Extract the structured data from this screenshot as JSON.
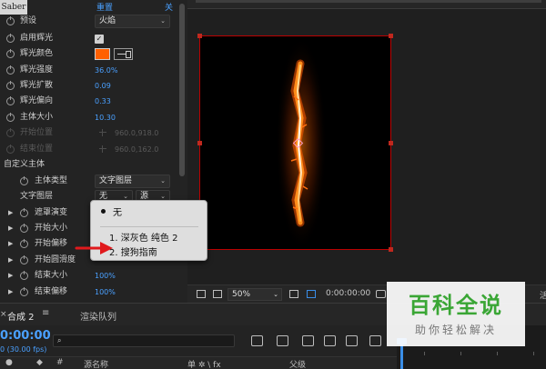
{
  "effects_panel": {
    "badge": "Saber",
    "reset": "重置",
    "about": "关",
    "rows": [
      {
        "label": "预设",
        "value": "火焰"
      },
      {
        "label": "启用辉光",
        "value": "✓"
      },
      {
        "label": "辉光颜色",
        "value": ""
      },
      {
        "label": "辉光强度",
        "value": "36.0%"
      },
      {
        "label": "辉光扩散",
        "value": "0.09"
      },
      {
        "label": "辉光偏向",
        "value": "0.33"
      },
      {
        "label": "主体大小",
        "value": "10.30"
      },
      {
        "label": "开始位置",
        "value": "960.0,918.0"
      },
      {
        "label": "结束位置",
        "value": "960.0,162.0"
      }
    ],
    "section_title": "自定义主体",
    "body_type_label": "主体类型",
    "body_type_value": "文字图层",
    "text_layer_label": "文字图层",
    "text_layer_value": "无",
    "text_layer_source": "源",
    "collapsed_rows": [
      {
        "label": "遮罩演变",
        "value": ""
      },
      {
        "label": "开始大小",
        "value": ""
      },
      {
        "label": "开始偏移",
        "value": ""
      },
      {
        "label": "开始圆滑度",
        "value": ""
      },
      {
        "label": "结束大小",
        "value": "100%"
      },
      {
        "label": "结束偏移",
        "value": "100%"
      }
    ]
  },
  "popup": {
    "options": [
      "无",
      "1. 深灰色 纯色 2",
      "2. 搜狗指南"
    ],
    "selected_index": 0
  },
  "viewer": {
    "zoom": "50%",
    "timecode": "0:00:00:00",
    "trailing": "活"
  },
  "timeline": {
    "close": "×",
    "comp_tab": "合成 2",
    "menu": "≡",
    "render_tab": "渲染队列",
    "time": "0:00:00",
    "fps": "0 (30.00 fps)",
    "search_icon": "⌕",
    "headers": {
      "hash": "#",
      "source_name": "源名称",
      "switches": "单 ✲ \\ fx",
      "parent": "父级"
    }
  },
  "watermark": {
    "main": "百科全说",
    "sub": "助你轻松解决"
  },
  "colors": {
    "accent_blue": "#4aa0ff",
    "glow_orange": "#ff6000",
    "arrow_red": "#e0191c",
    "watermark_green": "#3aa635"
  }
}
